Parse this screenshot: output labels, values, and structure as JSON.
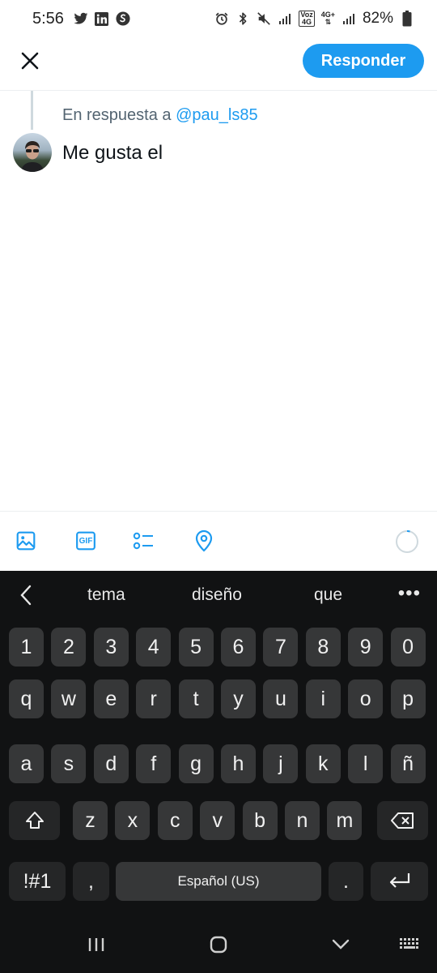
{
  "status_bar": {
    "time": "5:56",
    "battery": "82%",
    "net_labels": {
      "voz": "Voz",
      "4g": "4G",
      "4gplus": "4G+"
    },
    "icons": [
      "twitter-icon",
      "linkedin-icon",
      "shazam-icon",
      "alarm-icon",
      "bluetooth-icon",
      "mute-icon",
      "signal-icon",
      "battery-icon"
    ]
  },
  "header": {
    "close_icon": "close-icon",
    "reply_button": "Responder"
  },
  "compose": {
    "in_reply_prefix": "En respuesta a",
    "in_reply_mention": "@pau_ls85",
    "text": "Me gusta el"
  },
  "toolbar": {
    "icons": [
      "image-icon",
      "gif-icon",
      "poll-icon",
      "location-icon"
    ],
    "gif_label": "GIF"
  },
  "keyboard": {
    "suggestions": [
      "tema",
      "diseño",
      "que"
    ],
    "more": "•••",
    "rows": {
      "numbers": [
        "1",
        "2",
        "3",
        "4",
        "5",
        "6",
        "7",
        "8",
        "9",
        "0"
      ],
      "row1": [
        "q",
        "w",
        "e",
        "r",
        "t",
        "y",
        "u",
        "i",
        "o",
        "p"
      ],
      "row2": [
        "a",
        "s",
        "d",
        "f",
        "g",
        "h",
        "j",
        "k",
        "l",
        "ñ"
      ],
      "row3": [
        "z",
        "x",
        "c",
        "v",
        "b",
        "n",
        "m"
      ]
    },
    "symbols_key": "!#1",
    "comma_key": ",",
    "space_key": "Español (US)",
    "period_key": "."
  },
  "colors": {
    "accent": "#1d9bf0",
    "keyboard_bg": "#111213",
    "key_bg": "#363738"
  }
}
